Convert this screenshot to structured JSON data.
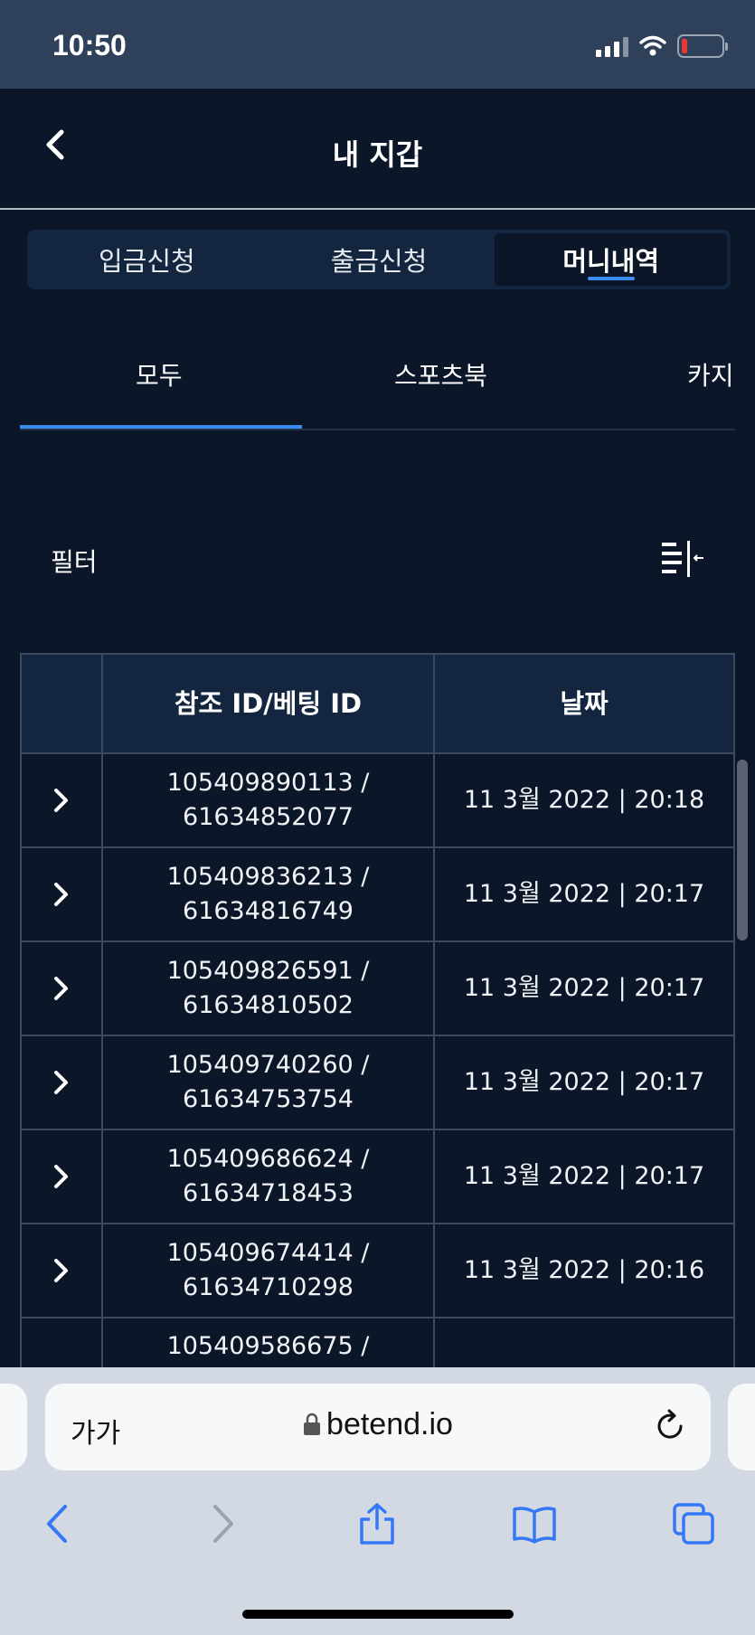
{
  "status_bar": {
    "time": "10:50"
  },
  "header": {
    "title": "내 지갑"
  },
  "segments": [
    {
      "label": "입금신청",
      "active": false
    },
    {
      "label": "출금신청",
      "active": false
    },
    {
      "label": "머니내역",
      "active": true
    }
  ],
  "sub_tabs": [
    {
      "label": "모두",
      "active": true
    },
    {
      "label": "스포츠북",
      "active": false
    },
    {
      "label": "카지",
      "active": false
    }
  ],
  "filter": {
    "label": "필터"
  },
  "table": {
    "columns": [
      "참조 ID/베팅 ID",
      "날짜"
    ],
    "rows": [
      {
        "ref": "105409890113 /",
        "bet": "61634852077",
        "date": "11 3월 2022 | 20:18"
      },
      {
        "ref": "105409836213 /",
        "bet": "61634816749",
        "date": "11 3월 2022 | 20:17"
      },
      {
        "ref": "105409826591 /",
        "bet": "61634810502",
        "date": "11 3월 2022 | 20:17"
      },
      {
        "ref": "105409740260 /",
        "bet": "61634753754",
        "date": "11 3월 2022 | 20:17"
      },
      {
        "ref": "105409686624 /",
        "bet": "61634718453",
        "date": "11 3월 2022 | 20:17"
      },
      {
        "ref": "105409674414 /",
        "bet": "61634710298",
        "date": "11 3월 2022 | 20:16"
      },
      {
        "ref": "105409586675 /",
        "bet": "",
        "date": ""
      }
    ]
  },
  "browser": {
    "text_size_label": "가가",
    "url": "betend.io"
  },
  "colors": {
    "background": "#0b1629",
    "accent": "#3c8cf0",
    "browser_tint": "#3478f6"
  }
}
